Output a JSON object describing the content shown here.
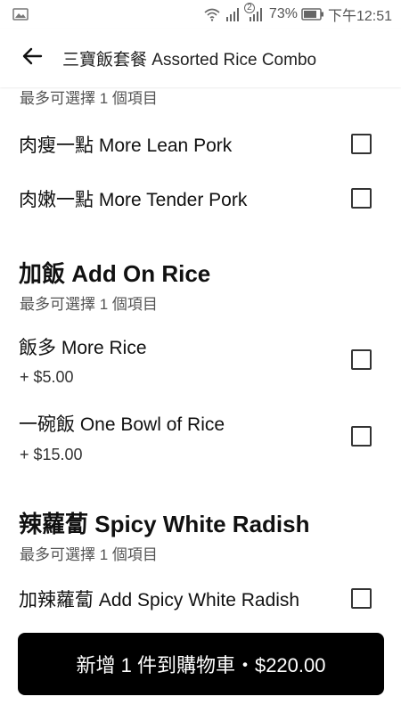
{
  "status_bar": {
    "battery": "73%",
    "time": "下午12:51",
    "sim_badge": "2",
    "icons": [
      "image-icon",
      "wifi-icon",
      "signal-icon",
      "signal-2-icon",
      "battery-icon"
    ]
  },
  "header": {
    "title": "三寶飯套餐 Assorted Rice Combo",
    "back_icon": "back-arrow-icon"
  },
  "sections": [
    {
      "subtitle": "最多可選擇 1 個項目",
      "options": [
        {
          "label": "肉瘦一點 More Lean Pork",
          "checked": false
        },
        {
          "label": "肉嫩一點 More Tender Pork",
          "checked": false
        }
      ]
    },
    {
      "title": "加飯 Add On Rice",
      "subtitle": "最多可選擇 1 個項目",
      "options": [
        {
          "label": "飯多 More Rice",
          "price": "+ $5.00",
          "checked": false
        },
        {
          "label": "一碗飯 One Bowl of Rice",
          "price": "+ $15.00",
          "checked": false
        }
      ]
    },
    {
      "title": "辣蘿蔔 Spicy White Radish",
      "subtitle": "最多可選擇 1 個項目",
      "options": [
        {
          "label": "加辣蘿蔔 Add Spicy White Radish",
          "checked": false
        }
      ]
    }
  ],
  "cart_button": {
    "label": "新增 1 件到購物車・$220.00"
  },
  "colors": {
    "cart_button_bg": "#000000",
    "text": "#111111",
    "subtext": "#555555"
  }
}
